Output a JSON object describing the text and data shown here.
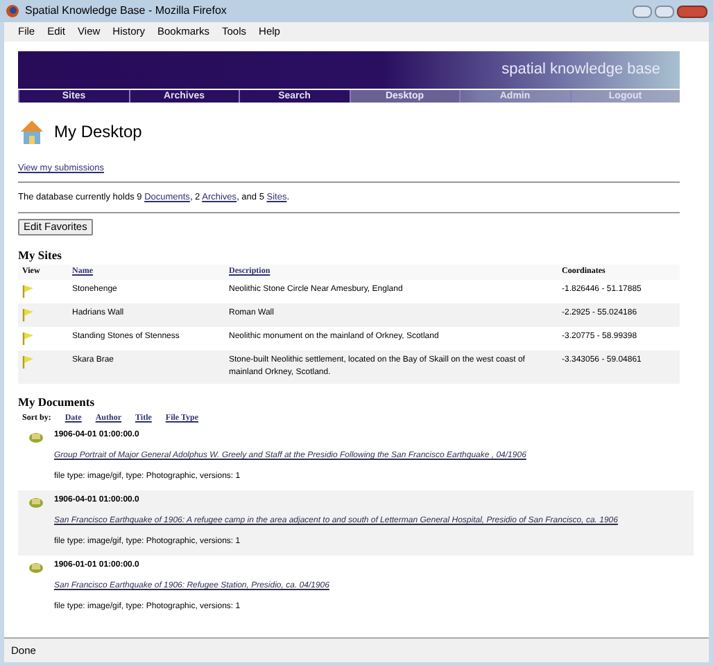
{
  "window": {
    "title": "Spatial Knowledge Base - Mozilla Firefox"
  },
  "menu": [
    "File",
    "Edit",
    "View",
    "History",
    "Bookmarks",
    "Tools",
    "Help"
  ],
  "banner": {
    "title": "spatial knowledge base"
  },
  "nav": [
    {
      "label": "Sites",
      "selected": false
    },
    {
      "label": "Archives",
      "selected": false
    },
    {
      "label": "Search",
      "selected": false
    },
    {
      "label": "Desktop",
      "selected": true
    },
    {
      "label": "Admin",
      "selected": false
    },
    {
      "label": "Logout",
      "selected": false
    }
  ],
  "page": {
    "title": "My Desktop",
    "submissions_link": "View my submissions",
    "stats": [
      {
        "kind": "text",
        "text": "The database currently holds 9 "
      },
      {
        "kind": "link",
        "text": "Documents"
      },
      {
        "kind": "text",
        "text": ", 2 "
      },
      {
        "kind": "link",
        "text": "Archives"
      },
      {
        "kind": "text",
        "text": ", and 5 "
      },
      {
        "kind": "link",
        "text": "Sites"
      },
      {
        "kind": "text",
        "text": "."
      }
    ],
    "edit_button": "Edit Favorites"
  },
  "sites": {
    "title": "My Sites",
    "columns": [
      {
        "label": "View",
        "link": false
      },
      {
        "label": "Name",
        "link": true
      },
      {
        "label": "Description",
        "link": true
      },
      {
        "label": "Coordinates",
        "link": false
      }
    ],
    "rows": [
      {
        "name": "Stonehenge",
        "description": "Neolithic Stone Circle Near Amesbury, England",
        "coordinates": "-1.826446 - 51.17885"
      },
      {
        "name": "Hadrians Wall",
        "description": "Roman Wall",
        "coordinates": "-2.2925 - 55.024186"
      },
      {
        "name": "Standing Stones of Stenness",
        "description": "Neolithic monument on the mainland of Orkney, Scotland",
        "coordinates": "-3.20775 - 58.99398"
      },
      {
        "name": "Skara Brae",
        "description": "Stone-built Neolithic settlement, located on the Bay of Skaill on the west coast of mainland Orkney, Scotland.",
        "coordinates": "-3.343056 - 59.04861"
      }
    ]
  },
  "documents": {
    "title": "My Documents",
    "sort_label": "Sort by:",
    "sort_links": [
      "Date",
      "Author",
      "Title",
      "File Type"
    ],
    "items": [
      {
        "date": "1906-04-01 01:00:00.0",
        "title": "Group Portrait of Major General Adolphus W. Greely and Staff at the Presidio Following the San Francisco Earthquake , 04/1906",
        "meta": "file type: image/gif, type: Photographic, versions: 1"
      },
      {
        "date": "1906-04-01 01:00:00.0",
        "title": "San Francisco Earthquake of 1906: A refugee camp in the area adjacent to and south of Letterman General Hospital, Presidio of San Francisco, ca. 1906",
        "meta": "file type: image/gif, type: Photographic, versions: 1"
      },
      {
        "date": "1906-01-01 01:00:00.0",
        "title": "San Francisco Earthquake of 1906: Refugee Station, Presidio, ca. 04/1906",
        "meta": "file type: image/gif, type: Photographic, versions: 1"
      }
    ]
  },
  "status_bar": {
    "text": "Done"
  }
}
